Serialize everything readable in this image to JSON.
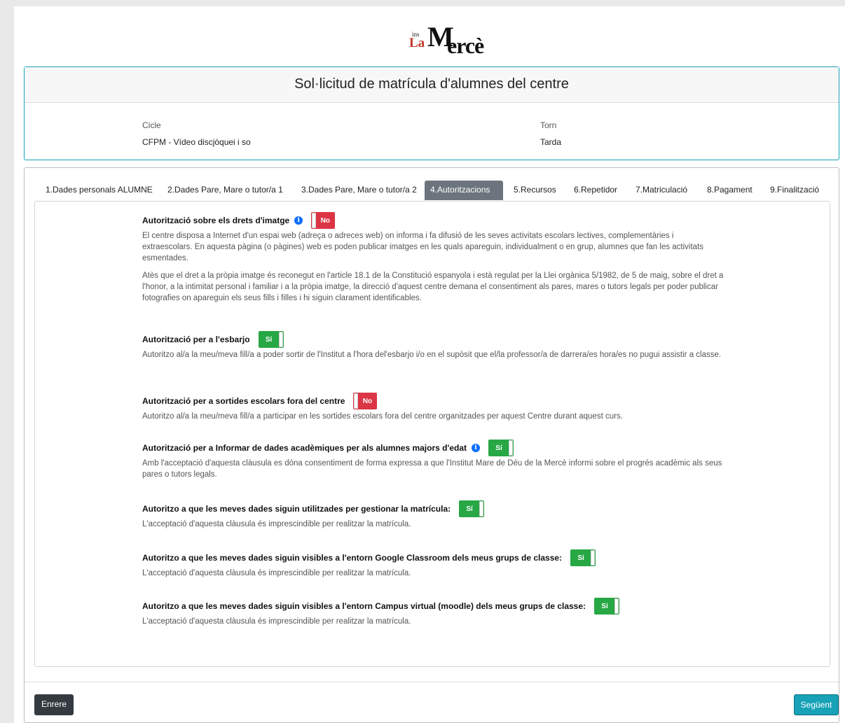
{
  "logo": {
    "ins": "ins",
    "la": "La",
    "m1": "M",
    "m2": "ercè"
  },
  "header": {
    "title": "Sol·licitud de matrícula d'alumnes del centre"
  },
  "enrollment": {
    "cicle_label": "Cicle",
    "cicle_value": "CFPM - Vídeo discjòquei i so",
    "torn_label": "Torn",
    "torn_value": "Tarda"
  },
  "tabs": [
    {
      "label": "1.Dades personals ALUMNE"
    },
    {
      "label": "2.Dades Pare, Mare o tutor/a 1"
    },
    {
      "label": "3.Dades Pare, Mare o tutor/a 2"
    },
    {
      "label": "4.Autoritzacions",
      "active": true
    },
    {
      "label": "5.Recursos"
    },
    {
      "label": "6.Repetidor"
    },
    {
      "label": "7.Matriculació"
    },
    {
      "label": "8.Pagament"
    },
    {
      "label": "9.Finalització"
    }
  ],
  "authorizations": [
    {
      "title": "Autorització sobre els drets d'imatge",
      "info_icon": "info-icon",
      "value": false,
      "toggle_label": "No",
      "paragraphs": [
        "El centre disposa a Internet d'un espai web (adreça o adreces web) on informa i fa difusió de les seves activitats escolars lectives, complementàries i extraescolars. En aquesta pàgina (o pàgines) web es poden publicar imatges en les quals apareguin, individualment o en grup, alumnes que fan les activitats esmentades.",
        "Atès que el dret a la pròpia imatge és reconegut en l'article 18.1 de la Constitució espanyola i està regulat per la Llei orgànica 5/1982, de 5 de maig, sobre el dret a l'honor, a la intimitat personal i familiar i a la pròpia imatge, la direcció d'aquest centre demana el consentiment als pares, mares o tutors legals per poder publicar fotografies on apareguin els seus fills i filles i hi siguin clarament identificables."
      ]
    },
    {
      "title": "Autorització per a l'esbarjo",
      "value": true,
      "toggle_label": "Sí",
      "paragraphs": [
        "Autoritzo al/a la meu/meva fill/a a poder sortir de l'Institut a l'hora del'esbarjo i/o en el supòsit que el/la professor/a de darrera/es hora/es no pugui assistir a classe."
      ]
    },
    {
      "title": "Autorització per a sortides escolars fora del centre",
      "value": false,
      "toggle_label": "No",
      "paragraphs": [
        "Autoritzo al/a la meu/meva fill/a a participar en les sortides escolars fora del centre organitzades per aquest Centre durant aquest curs."
      ]
    },
    {
      "title": "Autorització per a Informar de dades acadèmiques per als alumnes majors d'edat",
      "info_icon": "info-icon",
      "value": true,
      "toggle_label": "Sí",
      "paragraphs": [
        "Amb l'acceptació d'aquesta clàusula es dóna consentiment de forma expressa a que l'Institut Mare de Déu de la Mercè informi sobre el progrés acadèmic als seus pares o tutors legals."
      ]
    },
    {
      "title": "Autoritzo a que les meves dades siguin utilitzades per gestionar la matrícula:",
      "value": true,
      "toggle_label": "Sí",
      "paragraphs": [
        "L'acceptació d'aquesta clàusula és imprescindible per realitzar la matrícula."
      ]
    },
    {
      "title": "Autoritzo a que les meves dades siguin visibles a l'entorn Google Classroom dels meus grups de classe:",
      "value": true,
      "toggle_label": "Sí",
      "paragraphs": [
        "L'acceptació d'aquesta clàusula és imprescindible per realitzar la matrícula."
      ]
    },
    {
      "title": "Autoritzo a que les meves dades siguin visibles a l'entorn Campus virtual (moodle) dels meus grups de classe:",
      "value": true,
      "toggle_label": "Sí",
      "paragraphs": [
        "L'acceptació d'aquesta clàusula és imprescindible per realitzar la matrícula."
      ]
    }
  ],
  "footer": {
    "prev_label": "Enrere",
    "next_label": "Següent"
  },
  "colors": {
    "accent": "#17a2b8",
    "active_tab": "#6c757d",
    "toggle_on": "#28a745",
    "toggle_off": "#dc3545",
    "prev_button": "#343a40"
  }
}
